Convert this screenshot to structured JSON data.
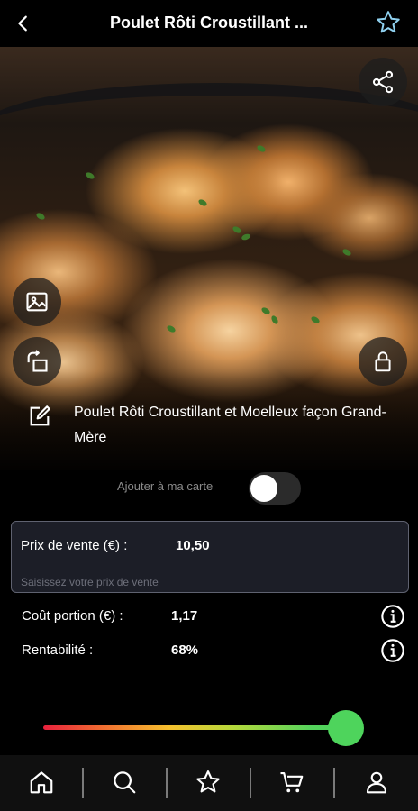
{
  "header": {
    "title": "Poulet Rôti Croustillant ..."
  },
  "recipe": {
    "name": "Poulet Rôti Croustillant et Moelleux façon Grand-Mère"
  },
  "menu_toggle": {
    "label": "Ajouter à ma carte",
    "on": false
  },
  "price": {
    "label": "Prix de vente (€) :",
    "value": "10,50",
    "placeholder": "Saisissez votre prix de vente"
  },
  "cost": {
    "label": "Coût portion (€) :",
    "value": "1,17"
  },
  "profitability": {
    "label": "Rentabilité :",
    "value": "68%",
    "slider_fraction": 0.68
  },
  "icons": {
    "back": "chevron-left-icon",
    "favorite": "star-outline-icon",
    "share": "share-icon",
    "image": "image-icon",
    "rotate": "rotate-icon",
    "lock": "lock-icon",
    "edit": "edit-icon",
    "info": "info-icon",
    "nav": [
      "home-icon",
      "search-icon",
      "star-icon",
      "cart-icon",
      "user-icon"
    ]
  },
  "colors": {
    "accent_green": "#4ed45c",
    "star_outline": "#8fd0ee",
    "gradient_start": "#e8213d",
    "gradient_end": "#46d35a"
  }
}
